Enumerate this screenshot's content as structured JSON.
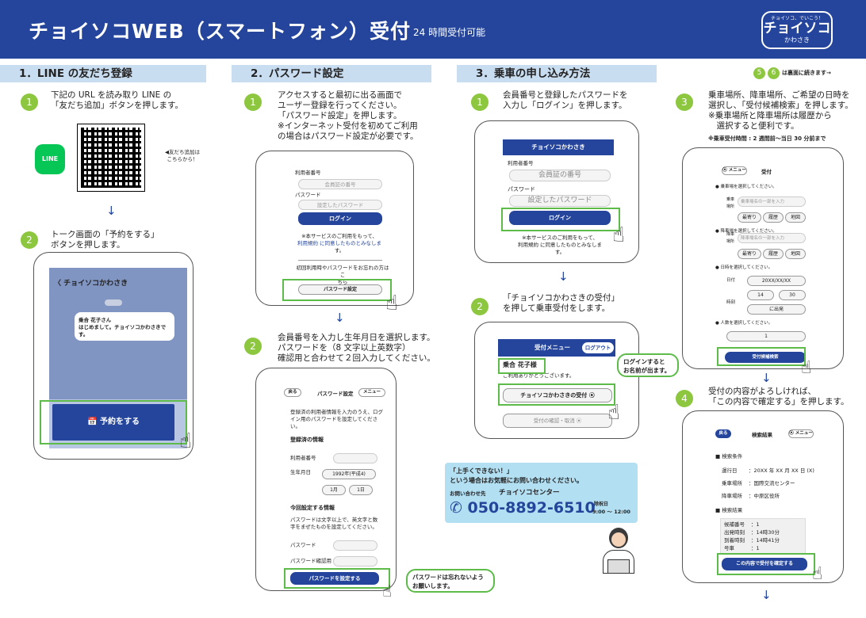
{
  "header": {
    "title": "チョイソコWEB（スマートフォン）受付",
    "subtitle": "24 時間受付可能"
  },
  "logo": {
    "top": "チョイソコ、でいこう！",
    "main": "チョイソコ",
    "sub": "かわさき"
  },
  "sec1": {
    "title": "1．LINE の友だち登録",
    "step1_num": "1",
    "step1_text": [
      "下記の URL を読み取り LINE の",
      "「友だち追加」ボタンを押します。"
    ],
    "line_label": "LINE",
    "friend_note": [
      "◀友だち追加は",
      "こちらから！"
    ],
    "step2_num": "2",
    "step2_text": [
      "トーク画面の「予約をする」",
      "ボタンを押します。"
    ],
    "chat_title": "チョイソコかわさき",
    "chat_msg": [
      "乗合 花子さん",
      "はじめまして。チョイソコかわさきです。"
    ],
    "reserve_btn": "予約をする"
  },
  "sec2": {
    "title": "2．パスワード設定",
    "step1_num": "1",
    "step1_text": [
      "アクセスすると最初に出る画面で",
      "ユーザー登録を行ってください。",
      "「パスワード設定」を押します。",
      "※インターネット受付を初めてご利用",
      "の場合はパスワード設定が必要です。"
    ],
    "login": {
      "member_label": "利用者番号",
      "member_ph": "会員証の番号",
      "pw_label": "パスワード",
      "pw_ph": "設定したパスワード",
      "login_btn": "ログイン",
      "agree": [
        "※本サービスのご利用をもって、",
        "利用規約 に同意したものとみなしま",
        "す。"
      ],
      "forget": [
        "初回利用時やパスワードをお忘れの方はこ",
        "ちら"
      ],
      "pw_set_btn": "パスワード設定"
    },
    "step2_num": "2",
    "step2_text": [
      "会員番号を入力し生年月日を選択します。",
      "パスワードを（8 文字以上英数字）",
      "確認用と合わせて２回入力してください。"
    ],
    "pwform": {
      "back": "戻る",
      "title": "パスワード設定",
      "menu": "メニュー",
      "intro": [
        "登録済の利用者情報を入力のうえ、ログ",
        "イン用のパスワードを設定してくださ",
        "い。"
      ],
      "reg_head": "登録済の情報",
      "member_label": "利用者番号",
      "birth_label": "生年月日",
      "year": "1992年(平成4)",
      "month": "1月",
      "day": "1日",
      "new_head": "今回設定する情報",
      "pw_note": [
        "パスワードは文字以上で、英文字と数",
        "字をまぜたものを設定してください。"
      ],
      "pw_label": "パスワード",
      "pw_confirm": "パスワード確認用",
      "submit_btn": "パスワードを設定する"
    },
    "callout": [
      "パスワードは忘れないよう",
      "お願いします。"
    ]
  },
  "sec3": {
    "title": "3．乗車の申し込み方法",
    "continue": "は裏面に続きます→",
    "cont_num5": "5",
    "cont_num6": "6",
    "step1_num": "1",
    "step1_text": [
      "会員番号と登録したパスワードを",
      "入力し「ログイン」を押します。"
    ],
    "login": {
      "header": "チョイソコかわさき",
      "member_label": "利用者番号",
      "member_ph": "会員証の番号",
      "pw_label": "パスワード",
      "pw_ph": "設定したパスワード",
      "login_btn": "ログイン",
      "agree": [
        "※本サービスのご利用をもって、",
        "利用規約 に同意したものとみなしま",
        "す。"
      ]
    },
    "step2_num": "2",
    "step2_text": [
      "「チョイソコかわさきの受付」",
      "を押して乗車受付をします。"
    ],
    "menu": {
      "title": "受付メニュー",
      "logout": "ログアウト",
      "name": "乗合 花子様",
      "thanks": "ご利用ありがとうございます。",
      "reception_btn": "チョイソコかわさきの受付",
      "confirm_btn": "受付の確認・取消"
    },
    "callout": [
      "ログインすると",
      "お名前が出ます。"
    ],
    "contact": {
      "line1": "「上手くできない！」",
      "line2": "という場合はお気軽にお問い合わせください。",
      "label": "お問い合わせ先",
      "center": "チョイソコセンター",
      "phone": "050-8892-6510",
      "hours_label": "除祝日",
      "hours": "9:00 ～ 12:00"
    },
    "step3_num": "3",
    "step3_text": [
      "乗車場所、降車場所、ご希望の日時を",
      "選択し、「受付候補検索」を押します。",
      "※乗車場所と降車場所は履歴から",
      "　選択すると便利です。"
    ],
    "step3_note": "※乗車受付時間 : 2 週間前～当日 30 分前まで",
    "form": {
      "menu": "メニュー",
      "title": "受付",
      "select_ride": "● 乗車場を選択してください。",
      "ride_label": "乗車場所",
      "ride_ph": "乗車場名の一部を入力",
      "fav": "最寄り",
      "history": "履歴",
      "map": "地図",
      "select_drop": "● 降車場を選択してください。",
      "drop_label": "降車場所",
      "drop_ph": "降車場名の一部を入力",
      "select_date": "● 日時を選択してください。",
      "date_label": "日付",
      "date_val": "20XX/XX/XX",
      "time_label": "時刻",
      "hour": "14",
      "minute": "30",
      "depart": "に出発",
      "select_people": "● 人数を選択してください。",
      "people": "1",
      "search_btn": "受付候補検索"
    },
    "step4_num": "4",
    "step4_text": [
      "受付の内容がよろしければ、",
      "「この内容で確定する」を押します。"
    ],
    "result": {
      "back": "戻る",
      "title": "検索結果",
      "menu": "メニュー",
      "cond_head": "■ 検索条件",
      "date_label": "運行日",
      "date_val": "：20XX 年 XX 月 XX 日 (X)",
      "ride_label": "乗車場所",
      "ride_val": "：国際交流センター",
      "drop_label": "降車場所",
      "drop_val": "：中原区役所",
      "res_head": "■ 検索結果",
      "cand_label": "候補番号",
      "cand_val": "：1",
      "dep_label": "出発時刻",
      "dep_val": "：14時30分",
      "arr_label": "到着時刻",
      "arr_val": "：14時41分",
      "car_label": "号車",
      "car_val": "：1",
      "confirm_btn": "この内容で受付を確定する"
    }
  }
}
